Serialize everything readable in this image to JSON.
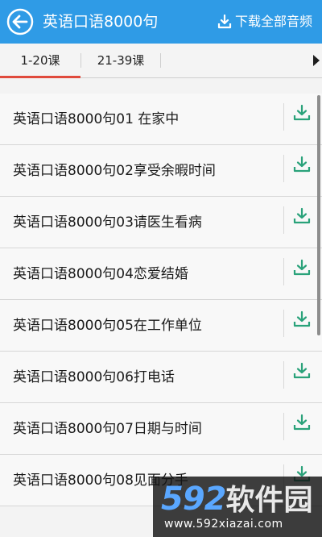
{
  "header": {
    "title": "英语口语8000句",
    "download_all_label": "下载全部音频"
  },
  "tabs": [
    {
      "label": "1-20课",
      "selected": true
    },
    {
      "label": "21-39课",
      "selected": false
    }
  ],
  "lessons": [
    {
      "title": "英语口语8000句01 在家中"
    },
    {
      "title": "英语口语8000句02享受余暇时间"
    },
    {
      "title": "英语口语8000句03请医生看病"
    },
    {
      "title": "英语口语8000句04恋爱结婚"
    },
    {
      "title": "英语口语8000句05在工作单位"
    },
    {
      "title": "英语口语8000句06打电话"
    },
    {
      "title": "英语口语8000句07日期与时间"
    },
    {
      "title": "英语口语8000句08见面分手"
    }
  ],
  "watermark": {
    "logo_number": "592",
    "logo_text": "软件园",
    "url": "www.592xiazai.com"
  },
  "colors": {
    "header_bg": "#2f9be6",
    "tab_indicator": "#e04a3c",
    "download_icon": "#2aa27a"
  },
  "icons": {
    "back": "back-arrow-circle-icon",
    "download_all": "download-tray-icon",
    "row_download": "download-tray-icon",
    "tab_more": "triangle-right-icon"
  }
}
